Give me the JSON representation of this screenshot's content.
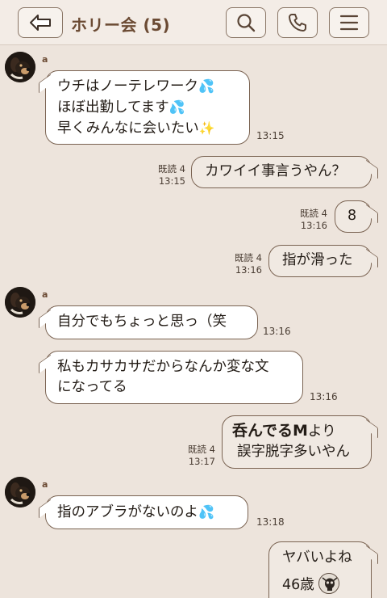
{
  "header": {
    "title": "ホリー会 (5)"
  },
  "messages": {
    "m1": {
      "sender": "a",
      "line1": "ウチはノーテレワーク",
      "line2": "ほぼ出勤してます",
      "line3": "早くみんなに会いたい",
      "time": "13:15"
    },
    "m2": {
      "text": "カワイイ事言うやん？",
      "read": "既読 4",
      "time": "13:15"
    },
    "m3": {
      "text": "8",
      "read": "既読 4",
      "time": "13:16"
    },
    "m4": {
      "text": "指が滑った",
      "read": "既読 4",
      "time": "13:16"
    },
    "m5": {
      "sender": "a",
      "text": "自分でもちょっと思っ（笑",
      "time": "13:16"
    },
    "m6": {
      "line1": "私もカサカサだからなんか変な文",
      "line2": "になってる",
      "time": "13:16"
    },
    "m7": {
      "line1_bold": "呑んでるM",
      "line1_rest": "より",
      "line2": "誤字脱字多いやん",
      "read": "既読 4",
      "time": "13:17"
    },
    "m8": {
      "sender": "a",
      "text": "指のアブラがないのよ",
      "time": "13:18"
    },
    "m9": {
      "line1": "ヤバいよね",
      "line2": "46歳"
    }
  },
  "colors": {
    "background": "#ede4dc",
    "header_bg": "#f3ece6",
    "accent_brown": "#6b4a33",
    "bubble_border": "#7a6352",
    "incoming_bubble": "#ffffff",
    "outgoing_bubble": "#f0e9e2"
  },
  "icons": [
    "back-arrow-icon",
    "search-icon",
    "phone-icon",
    "menu-icon",
    "sweat-drops-emoji",
    "sparkles-emoji",
    "skull-emoji"
  ]
}
